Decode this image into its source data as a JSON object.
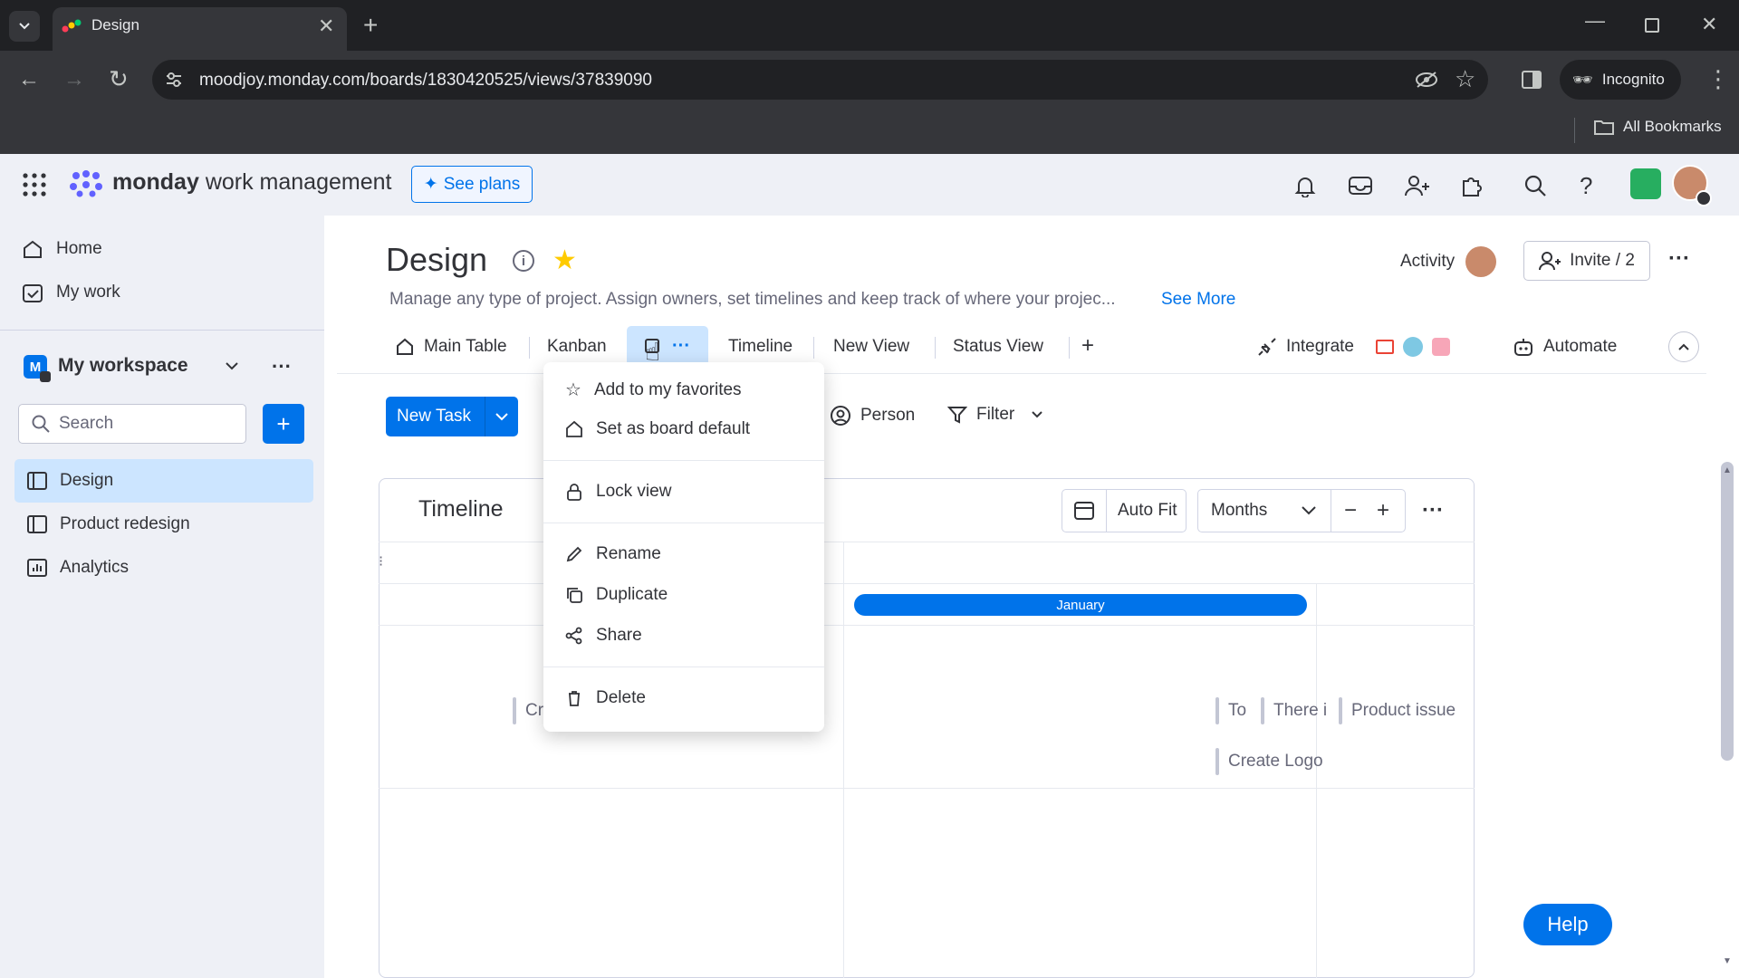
{
  "browser": {
    "tab_title": "Design",
    "url": "moodjoy.monday.com/boards/1830420525/views/37839090",
    "incognito_label": "Incognito",
    "bookmarks_label": "All Bookmarks"
  },
  "header": {
    "brand_bold": "monday",
    "brand_rest": "work management",
    "see_plans": "See plans"
  },
  "sidebar": {
    "home": "Home",
    "my_work": "My work",
    "workspace": "My workspace",
    "workspace_initial": "M",
    "search_placeholder": "Search",
    "boards": [
      {
        "label": "Design"
      },
      {
        "label": "Product redesign"
      },
      {
        "label": "Analytics"
      }
    ]
  },
  "board": {
    "title": "Design",
    "description": "Manage any type of project. Assign owners, set timelines and keep track of where your projec...",
    "see_more": "See More",
    "activity": "Activity",
    "invite": "Invite / 2"
  },
  "views": {
    "main_table": "Main Table",
    "kanban": "Kanban",
    "timeline": "Timeline",
    "new_view": "New View",
    "status_view": "Status View",
    "add": "+",
    "integrate": "Integrate",
    "automate": "Automate"
  },
  "actions": {
    "new_task": "New Task",
    "person": "Person",
    "filter": "Filter"
  },
  "timeline": {
    "title": "Timeline",
    "auto_fit": "Auto Fit",
    "scale": "Months",
    "month_label": "January",
    "tasks": {
      "cr": "Cr",
      "to": "To",
      "there": "There i",
      "product_issue": "Product issue",
      "create_logo": "Create Logo"
    }
  },
  "menu": {
    "items": [
      {
        "label": "Add to my favorites",
        "icon": "star-icon"
      },
      {
        "label": "Set as board default",
        "icon": "home-icon"
      },
      {
        "label": "Lock view",
        "icon": "lock-icon"
      },
      {
        "label": "Rename",
        "icon": "pencil-icon"
      },
      {
        "label": "Duplicate",
        "icon": "duplicate-icon"
      },
      {
        "label": "Share",
        "icon": "share-icon"
      },
      {
        "label": "Delete",
        "icon": "trash-icon"
      }
    ]
  },
  "help": "Help",
  "colors": {
    "primary": "#0073ea",
    "star": "#ffcb00",
    "surface": "#eef0f6"
  }
}
